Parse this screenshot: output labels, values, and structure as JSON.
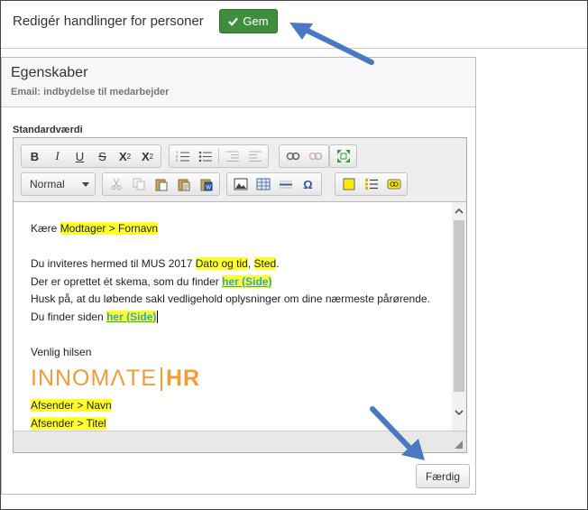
{
  "header": {
    "title": "Redigér handlinger for personer",
    "save_label": "Gem"
  },
  "panel": {
    "title": "Egenskaber",
    "subtitle": "Email: indbydelse til medarbejder",
    "field_label": "Standardværdi",
    "done_label": "Færdig"
  },
  "toolbar": {
    "format_value": "Normal",
    "bold": "B",
    "italic": "I",
    "underline": "U",
    "strike": "S",
    "subscript": "X",
    "superscript": "X",
    "sub_mark": "2",
    "sup_mark": "2",
    "omega": "Ω"
  },
  "content": {
    "greeting": "Kære",
    "recipient_field": "Modtager > Fornavn",
    "line1_text": "Du inviteres hermed til MUS 2017",
    "date_field": "Dato og tid",
    "comma": ",",
    "place_field": "Sted",
    "period": ".",
    "line2_text": "Der er oprettet ét skema, som du finder",
    "link1": "her (Side)",
    "line3_text": "Husk på, at du løbende sakl vedligehold oplysninger om dine nærmeste pårørende.",
    "line4_text": "Du finder siden",
    "link2": "her (Side)",
    "closing": "Venlig hilsen",
    "logo_text": "INNOMΛTE",
    "logo_hr": "HR",
    "sender_name": "Afsender > Navn",
    "sender_title": "Afsender > Titel"
  },
  "colors": {
    "save_button": "#3e8e3e",
    "highlight": "#ffff2a",
    "link": "#2aa4d8",
    "logo": "#f29c38",
    "arrow": "#4a78c2"
  }
}
